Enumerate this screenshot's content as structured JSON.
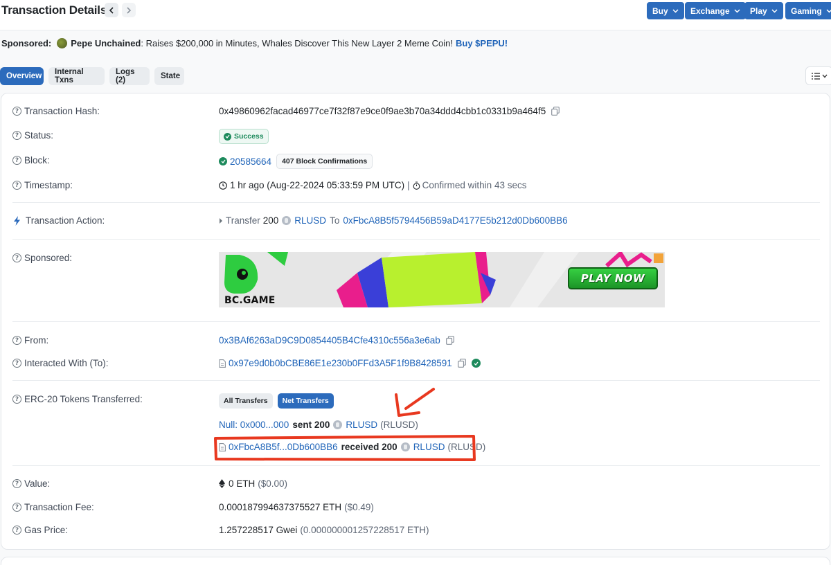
{
  "header": {
    "title": "Transaction Details",
    "menus": [
      "Buy",
      "Exchange",
      "Play",
      "Gaming"
    ]
  },
  "sponsor_line": {
    "label": "Sponsored:",
    "name": "Pepe Unchained",
    "text": ": Raises $200,000 in Minutes, Whales Discover This New Layer 2 Meme Coin!",
    "cta": "Buy $PEPU!"
  },
  "tabs": [
    "Overview",
    "Internal Txns",
    "Logs (2)",
    "State"
  ],
  "details": {
    "hash": {
      "label": "Transaction Hash:",
      "value": "0x49860962facad46977ce7f32f87e9ce0f9ae3b70a34ddd4cbb1c0331b9a464f5"
    },
    "status": {
      "label": "Status:",
      "value": "Success"
    },
    "block": {
      "label": "Block:",
      "value": "20585664",
      "confirmations": "407 Block Confirmations"
    },
    "timestamp": {
      "label": "Timestamp:",
      "value": "1 hr ago (Aug-22-2024 05:33:59 PM UTC)",
      "separator": "|",
      "confirmed": "Confirmed within 43 secs"
    },
    "action": {
      "label": "Transaction Action:",
      "verb": "Transfer",
      "amount": "200",
      "token": "RLUSD",
      "to_word": "To",
      "to_address": "0xFbcA8B5f5794456B59aD4177E5b212d0Db600BB6"
    },
    "sponsored": {
      "label": "Sponsored:",
      "banner_brand": "BC.GAME",
      "banner_cta": "PLAY NOW"
    },
    "from": {
      "label": "From:",
      "value": "0x3BAf6263aD9C9D0854405B4Cfe4310c556a3e6ab"
    },
    "to": {
      "label": "Interacted With (To):",
      "value": "0x97e9d0b0bCBE86E1e230b0FFd3A5F1f9B8428591"
    },
    "erc20": {
      "label": "ERC-20 Tokens Transferred:",
      "buttons": [
        "All Transfers",
        "Net Transfers"
      ],
      "transfers": [
        {
          "party": "Null: 0x000...000",
          "action": "sent 200",
          "token": "RLUSD",
          "symbol": "(RLUSD)"
        },
        {
          "party": "0xFbcA8B5f...0Db600BB6",
          "action": "received 200",
          "token": "RLUSD",
          "symbol": "(RLUSD)"
        }
      ]
    },
    "value": {
      "label": "Value:",
      "amount": "0 ETH",
      "usd": "($0.00)"
    },
    "fee": {
      "label": "Transaction Fee:",
      "amount": "0.000187994637375527 ETH",
      "usd": "($0.49)"
    },
    "gas": {
      "label": "Gas Price:",
      "amount": "1.257228517 Gwei",
      "eth": "(0.000000001257228517 ETH)"
    }
  },
  "colors": {
    "primary": "#2c6bbc",
    "link": "#1e63b8",
    "success": "#1d8a5c",
    "annotation": "#e8381f"
  }
}
